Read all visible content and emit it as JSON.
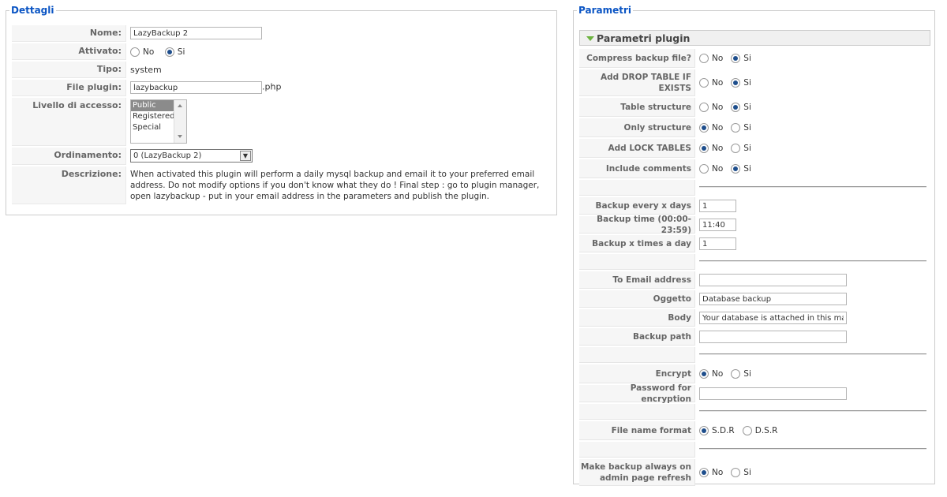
{
  "dettagli": {
    "legend": "Dettagli",
    "nome": {
      "label": "Nome:",
      "value": "LazyBackup 2"
    },
    "attivato": {
      "label": "Attivato:",
      "options": [
        "No",
        "Si"
      ],
      "selected": "Si"
    },
    "tipo": {
      "label": "Tipo:",
      "value": "system"
    },
    "file_plugin": {
      "label": "File plugin:",
      "value": "lazybackup",
      "suffix": ".php"
    },
    "livello": {
      "label": "Livello di accesso:",
      "options": [
        "Public",
        "Registered",
        "Special"
      ],
      "selected": "Public"
    },
    "ordinamento": {
      "label": "Ordinamento:",
      "value": "0 (LazyBackup 2)"
    },
    "descrizione": {
      "label": "Descrizione:",
      "text": "When activated this plugin will perform a daily mysql backup and email it to your preferred email address. Do not modify options if you don't know what they do ! Final step : go to plugin manager, open lazybackup - put in your email address in the parameters and publish the plugin."
    }
  },
  "parametri": {
    "legend": "Parametri",
    "section_title": "Parametri plugin",
    "compress": {
      "label": "Compress backup file?",
      "options": [
        "No",
        "Si"
      ],
      "selected": "Si"
    },
    "drop_table": {
      "label": "Add DROP TABLE IF EXISTS",
      "options": [
        "No",
        "Si"
      ],
      "selected": "Si"
    },
    "table_structure": {
      "label": "Table structure",
      "options": [
        "No",
        "Si"
      ],
      "selected": "Si"
    },
    "only_structure": {
      "label": "Only structure",
      "options": [
        "No",
        "Si"
      ],
      "selected": "No"
    },
    "lock_tables": {
      "label": "Add LOCK TABLES",
      "options": [
        "No",
        "Si"
      ],
      "selected": "No"
    },
    "include_comments": {
      "label": "Include comments",
      "options": [
        "No",
        "Si"
      ],
      "selected": "Si"
    },
    "backup_days": {
      "label": "Backup every x days",
      "value": "1"
    },
    "backup_time": {
      "label": "Backup time (00:00-23:59)",
      "value": "11:40"
    },
    "backup_times_day": {
      "label": "Backup x times a day",
      "value": "1"
    },
    "to_email": {
      "label": "To Email address",
      "value": ""
    },
    "oggetto": {
      "label": "Oggetto",
      "value": "Database backup"
    },
    "body": {
      "label": "Body",
      "value": "Your database is attached in this mail."
    },
    "backup_path": {
      "label": "Backup path",
      "value": ""
    },
    "encrypt": {
      "label": "Encrypt",
      "options": [
        "No",
        "Si"
      ],
      "selected": "No"
    },
    "password": {
      "label": "Password for encryption",
      "value": ""
    },
    "file_name_format": {
      "label": "File name format",
      "options": [
        "S.D.R",
        "D.S.R"
      ],
      "selected": "S.D.R"
    },
    "admin_refresh": {
      "label": "Make backup always on admin page refresh",
      "options": [
        "No",
        "Si"
      ],
      "selected": "No"
    }
  }
}
